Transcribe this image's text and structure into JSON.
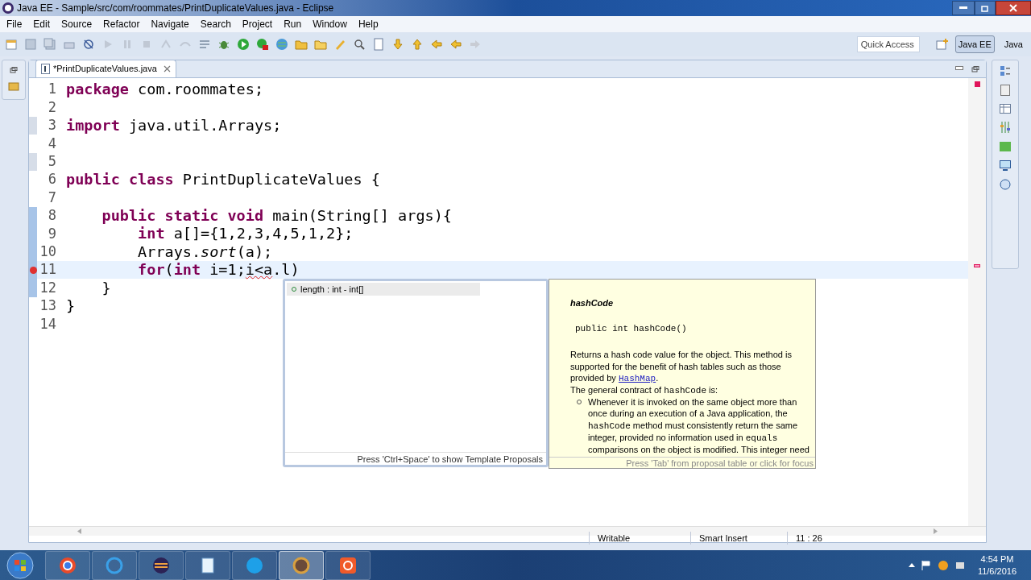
{
  "window": {
    "title": "Java EE - Sample/src/com/roommates/PrintDuplicateValues.java - Eclipse"
  },
  "menu": [
    "File",
    "Edit",
    "Source",
    "Refactor",
    "Navigate",
    "Search",
    "Project",
    "Run",
    "Window",
    "Help"
  ],
  "quick_access": {
    "placeholder": "Quick Access"
  },
  "perspectives": [
    {
      "label": "Java EE",
      "selected": true
    },
    {
      "label": "Java",
      "selected": false
    }
  ],
  "editor_tab": {
    "label": "*PrintDuplicateValues.java"
  },
  "code": [
    {
      "number": "1",
      "modified": false,
      "highlighted": false,
      "error": false,
      "current": false,
      "tokens": [
        {
          "text": "package",
          "kind": "keyword"
        },
        {
          "text": " com.roommates;",
          "kind": "plain"
        }
      ]
    },
    {
      "number": "2",
      "modified": false,
      "highlighted": false,
      "error": false,
      "current": false
    },
    {
      "number": "3",
      "modified": false,
      "highlighted": true,
      "error": false,
      "current": false,
      "tokens": [
        {
          "text": "import",
          "kind": "keyword"
        },
        {
          "text": " java.util.Arrays;",
          "kind": "plain"
        }
      ]
    },
    {
      "number": "4",
      "modified": false,
      "highlighted": false,
      "error": false,
      "current": false
    },
    {
      "number": "5",
      "modified": false,
      "highlighted": true,
      "error": false,
      "current": false
    },
    {
      "number": "6",
      "modified": false,
      "highlighted": false,
      "error": false,
      "current": false,
      "tokens": [
        {
          "text": "public class",
          "kind": "keyword"
        },
        {
          "text": " PrintDuplicateValues {",
          "kind": "plain"
        }
      ]
    },
    {
      "number": "7",
      "modified": false,
      "highlighted": false,
      "error": false,
      "current": false
    },
    {
      "number": "8",
      "modified": true,
      "highlighted": false,
      "error": false,
      "current": false,
      "tokens": [
        {
          "text": "    public static void",
          "kind": "keyword"
        },
        {
          "text": " main(String[] args){",
          "kind": "plain"
        }
      ]
    },
    {
      "number": "9",
      "modified": true,
      "highlighted": false,
      "error": false,
      "current": false,
      "tokens": [
        {
          "text": "        int",
          "kind": "keyword"
        },
        {
          "text": " a[]={1,2,3,4,5,1,2};",
          "kind": "plain"
        }
      ]
    },
    {
      "number": "10",
      "modified": true,
      "highlighted": false,
      "error": false,
      "current": false,
      "tokens": [
        {
          "text": "        Arrays.",
          "kind": "plain"
        },
        {
          "text": "sort",
          "kind": "static"
        },
        {
          "text": "(a);",
          "kind": "plain"
        }
      ]
    },
    {
      "number": "11",
      "modified": true,
      "highlighted": false,
      "error": true,
      "current": true,
      "tokens": [
        {
          "text": "        for",
          "kind": "keyword"
        },
        {
          "text": "(",
          "kind": "plain"
        },
        {
          "text": "int",
          "kind": "keyword"
        },
        {
          "text": " i=1;",
          "kind": "plain"
        },
        {
          "text": "i<a",
          "kind": "error"
        },
        {
          "text": ".l)",
          "kind": "plain"
        }
      ]
    },
    {
      "number": "12",
      "modified": true,
      "highlighted": false,
      "error": false,
      "current": false,
      "tokens": [
        {
          "text": "    }",
          "kind": "plain"
        }
      ]
    },
    {
      "number": "13",
      "modified": false,
      "highlighted": false,
      "error": false,
      "current": false,
      "tokens": [
        {
          "text": "}",
          "kind": "plain"
        }
      ]
    },
    {
      "number": "14",
      "modified": false,
      "highlighted": false,
      "error": false,
      "current": false
    }
  ],
  "proposals": {
    "items": [
      {
        "label": "length : int - int[]",
        "selected": true
      }
    ],
    "footer": "Press 'Ctrl+Space' to show Template Proposals"
  },
  "javadoc": {
    "title": "hashCode",
    "signature": "public int hashCode()",
    "paragraphs": [
      [
        {
          "text": "Returns a hash code value for the object. This method is supported for the benefit of hash tables such as those provided by ",
          "kind": "text"
        },
        {
          "text": "HashMap",
          "kind": "link"
        },
        {
          "text": ".",
          "kind": "text"
        }
      ],
      [
        {
          "text": "The general contract of ",
          "kind": "text"
        },
        {
          "text": "hashCode",
          "kind": "code"
        },
        {
          "text": " is:",
          "kind": "text"
        }
      ]
    ],
    "bullets": [
      [
        {
          "text": "Whenever it is invoked on the same object more than once during an execution of a Java application, the ",
          "kind": "text"
        },
        {
          "text": "hashCode",
          "kind": "code"
        },
        {
          "text": " method must consistently return the same integer, provided no information used in ",
          "kind": "text"
        },
        {
          "text": "equals",
          "kind": "code"
        },
        {
          "text": " comparisons on the object is modified. This integer need",
          "kind": "text"
        }
      ]
    ],
    "footer": "Press 'Tab' from proposal table or click for focus"
  },
  "status_bar": {
    "mode": "Writable",
    "insert": "Smart Insert",
    "position": "11 : 26"
  },
  "taskbar": {
    "time": "4:54 PM",
    "date": "11/6/2016"
  }
}
